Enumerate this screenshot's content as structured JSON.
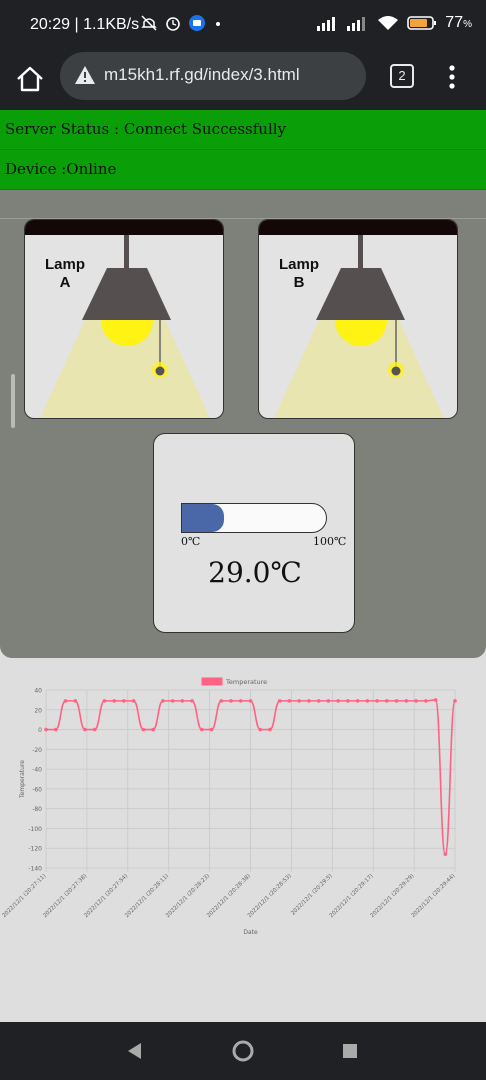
{
  "status_bar": {
    "time": "20:29 | 1.1KB/s",
    "battery": "77",
    "battery_unit": "%",
    "icons": [
      "mute-icon",
      "alarm-icon",
      "app-notification-icon",
      "dot-icon",
      "signal-icon",
      "signal-icon",
      "wifi-icon",
      "battery-icon"
    ]
  },
  "browser": {
    "url": "m15kh1.rf.gd/index/3.html",
    "tab_count": "2"
  },
  "server_status": "Server Status : Connect Successfully",
  "device_status": "Device :Online",
  "lamps": [
    {
      "label_line1": "Lamp",
      "label_line2": "A"
    },
    {
      "label_line1": "Lamp",
      "label_line2": "B"
    }
  ],
  "thermometer": {
    "min_label": "0℃",
    "max_label": "100℃",
    "value_text": "29.0℃",
    "fill_fraction": 0.29,
    "fill_color": "#4a68a8"
  },
  "colors": {
    "status_green": "#0a9f09",
    "panel_gray": "#7e817a",
    "series_color": "#ff6384"
  },
  "chart_data": {
    "type": "line",
    "legend": [
      "Temperature"
    ],
    "legend_placement": "top-center",
    "xlabel": "Date",
    "ylabel": "Temperature",
    "ylim": [
      -140,
      40
    ],
    "yticks": [
      40,
      20,
      0,
      -20,
      -40,
      -60,
      -80,
      -100,
      -120,
      -140
    ],
    "grid": true,
    "x_tick_labels": [
      "2022/12/1 (20:27:11)",
      "2022/12/1 (20:27:38)",
      "2022/12/1 (20:27:54)",
      "2022/12/1 (20:28:11)",
      "2022/12/1 (20:28:23)",
      "2022/12/1 (20:28:38)",
      "2022/12/1 (20:28:53)",
      "2022/12/1 (20:29:5)",
      "2022/12/1 (20:29:17)",
      "2022/12/1 (20:29:29)",
      "2022/12/1 (20:29:44)"
    ],
    "series": [
      {
        "name": "Temperature",
        "values": [
          0,
          0,
          29,
          29,
          0,
          0,
          29,
          29,
          29,
          29,
          0,
          0,
          29,
          29,
          29,
          29,
          0,
          0,
          29,
          29,
          29,
          29,
          0,
          0,
          29,
          29,
          29,
          29,
          29,
          29,
          29,
          29,
          29,
          29,
          29,
          29,
          29,
          29,
          29,
          29,
          30,
          -126,
          29
        ]
      }
    ]
  }
}
